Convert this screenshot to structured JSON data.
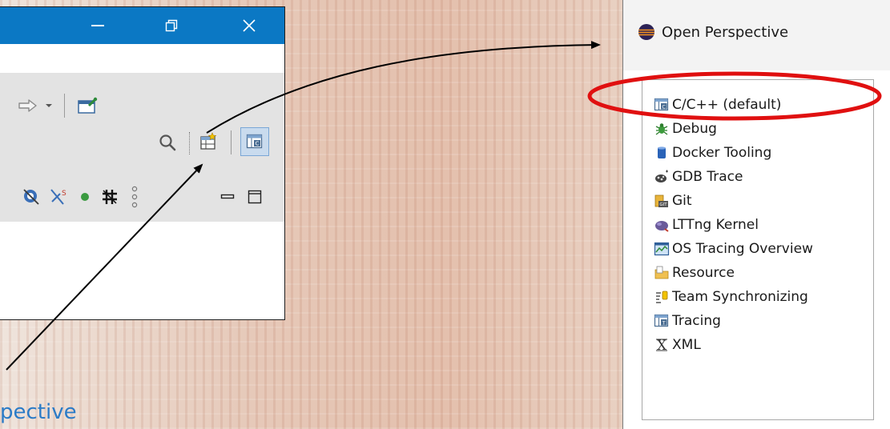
{
  "dialog": {
    "title": "Open Perspective",
    "items": [
      {
        "label": "C/C++ (default)",
        "icon": "cpp-perspective-icon"
      },
      {
        "label": "Debug",
        "icon": "debug-bug-icon"
      },
      {
        "label": "Docker Tooling",
        "icon": "docker-cylinder-icon"
      },
      {
        "label": "GDB Trace",
        "icon": "gdb-trace-icon"
      },
      {
        "label": "Git",
        "icon": "git-icon"
      },
      {
        "label": "LTTng Kernel",
        "icon": "lttng-kernel-icon"
      },
      {
        "label": "OS Tracing Overview",
        "icon": "os-tracing-chart-icon"
      },
      {
        "label": "Resource",
        "icon": "resource-folder-icon"
      },
      {
        "label": "Team Synchronizing",
        "icon": "team-sync-icon"
      },
      {
        "label": "Tracing",
        "icon": "tracing-icon"
      },
      {
        "label": "XML",
        "icon": "xml-icon"
      }
    ],
    "highlighted_index": 0
  },
  "window": {
    "title_bar_color": "#0b78c4",
    "buttons": [
      "minimize-icon",
      "restore-icon",
      "close-icon"
    ],
    "toolbar_icons": [
      "forward-arrow-icon",
      "dropdown-chevron-icon",
      "open-task-icon",
      "search-icon",
      "open-perspective-icon",
      "cpp-perspective-icon",
      "target-icon",
      "sync-icon",
      "green-dot-icon",
      "hash-icon",
      "kebab-icon",
      "minimize-view-icon",
      "maximize-view-icon"
    ]
  },
  "caption": {
    "text": "pective",
    "color": "#2b7bc7"
  },
  "colors": {
    "highlight_ellipse": "#e01010",
    "arrow": "#000000"
  }
}
